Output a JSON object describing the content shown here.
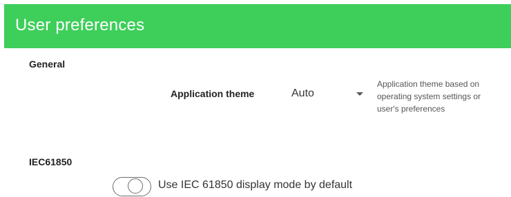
{
  "header": {
    "title": "User preferences",
    "background_color": "#3ecf5a"
  },
  "general": {
    "section_title": "General",
    "application_theme": {
      "label": "Application theme",
      "selected_value": "Auto",
      "help_text": "Application theme based on operating system settings or user's preferences"
    }
  },
  "iec61850": {
    "section_title": "IEC61850",
    "display_mode_toggle": {
      "label": "Use IEC 61850 display mode by default",
      "checked": false
    }
  }
}
